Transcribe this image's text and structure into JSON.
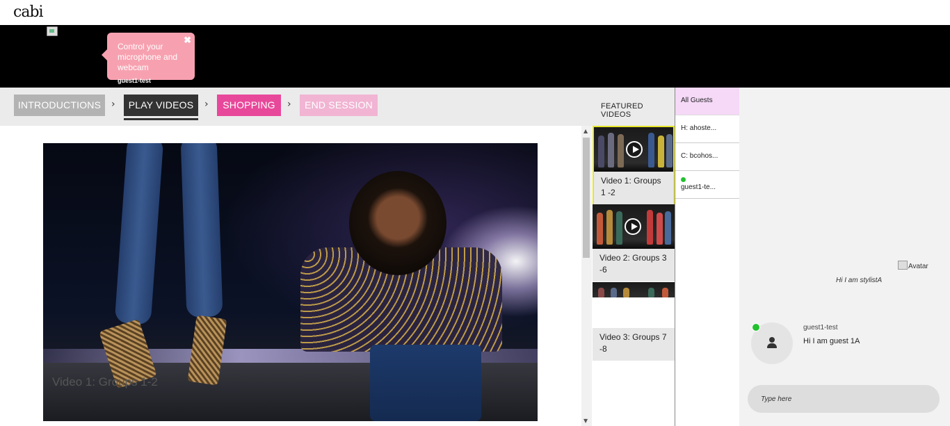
{
  "header": {
    "logo": "cabi"
  },
  "strip": {
    "tooltip_text": "Control your microphone and webcam",
    "close_glyph": "✖",
    "participant_name": "guest1-test"
  },
  "nav": {
    "steps": [
      {
        "label": "INTRODUCTIONS"
      },
      {
        "label": "PLAY VIDEOS"
      },
      {
        "label": "SHOPPING"
      },
      {
        "label": "END SESSION"
      }
    ],
    "chevron": "›",
    "featured_label": "FEATURED VIDEOS"
  },
  "main_video": {
    "caption": "Video 1: Groups 1-2"
  },
  "featured_videos": [
    {
      "title": "Video 1: Groups 1 -2",
      "active": true
    },
    {
      "title": "Video 2: Groups 3 -6",
      "active": false
    },
    {
      "title": "Video 3: Groups 7 -8",
      "active": false
    }
  ],
  "guests": {
    "all_label": "All Guests",
    "rows": [
      {
        "label": "H: ahoste..."
      },
      {
        "label": "C: bcohos..."
      },
      {
        "label": "guest1-te...",
        "online": true
      }
    ]
  },
  "chat": {
    "avatar_alt": "Avatar",
    "host_message": "Hi I am stylistA",
    "guest_name": "guest1-test",
    "guest_message": "Hi I am guest 1A",
    "input_placeholder": "Type here"
  },
  "colors": {
    "shopping": "#e8489a",
    "end_session": "#f1b4d3",
    "play_active": "#333333",
    "tooltip": "#f7a1b0",
    "online": "#22c12e",
    "active_card_border": "#e6e62a"
  }
}
